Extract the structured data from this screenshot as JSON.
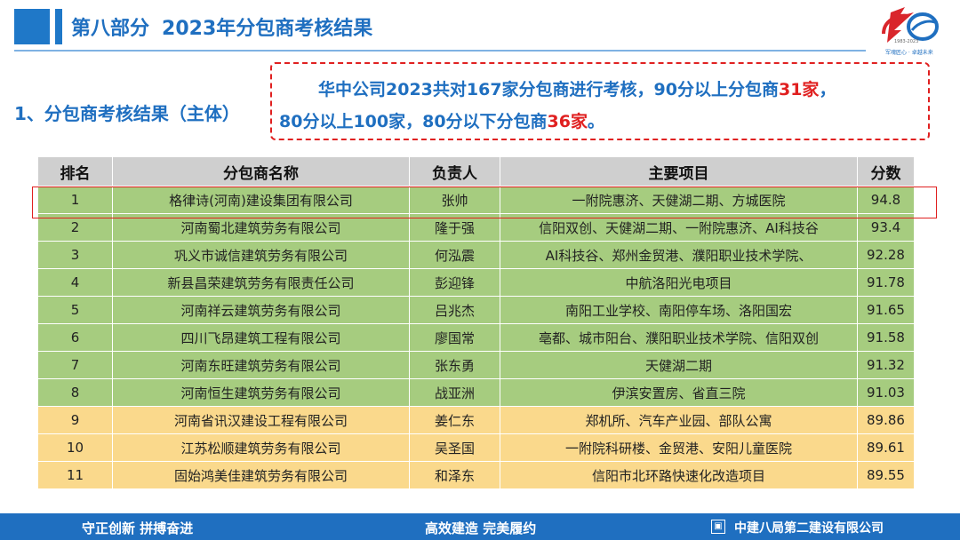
{
  "header": {
    "section": "第八部分",
    "title": "2023年分包商考核结果",
    "logo_years": "1983-2023",
    "logo_slogan": "军魂匠心 · 卓越未来"
  },
  "subtitle": "1、分包商考核结果（主体）",
  "summary": {
    "line1_before": "华中公司2023共对167家分包商进行考核，90分以上分包商",
    "line1_num": "31家",
    "line1_after": "，",
    "line2_before": "80分以上100家，80分以下分包商",
    "line2_num": "36家",
    "line2_after": "。"
  },
  "table": {
    "headers": [
      "排名",
      "分包商名称",
      "负责人",
      "主要项目",
      "分数"
    ],
    "rows": [
      [
        "1",
        "格律诗(河南)建设集团有限公司",
        "张帅",
        "一附院惠济、天健湖二期、方城医院",
        "94.8"
      ],
      [
        "2",
        "河南蜀北建筑劳务有限公司",
        "隆于强",
        "信阳双创、天健湖二期、一附院惠济、AI科技谷",
        "93.4"
      ],
      [
        "3",
        "巩义市诚信建筑劳务有限公司",
        "何泓震",
        "AI科技谷、郑州金贸港、濮阳职业技术学院、",
        "92.28"
      ],
      [
        "4",
        "新县昌荣建筑劳务有限责任公司",
        "彭迎锋",
        "中航洛阳光电项目",
        "91.78"
      ],
      [
        "5",
        "河南祥云建筑劳务有限公司",
        "吕兆杰",
        "南阳工业学校、南阳停车场、洛阳国宏",
        "91.65"
      ],
      [
        "6",
        "四川飞昂建筑工程有限公司",
        "廖国常",
        "亳都、城市阳台、濮阳职业技术学院、信阳双创",
        "91.58"
      ],
      [
        "7",
        "河南东旺建筑劳务有限公司",
        "张东勇",
        "天健湖二期",
        "91.32"
      ],
      [
        "8",
        "河南恒生建筑劳务有限公司",
        "战亚洲",
        "伊滨安置房、省直三院",
        "91.03"
      ],
      [
        "9",
        "河南省讯汉建设工程有限公司",
        "姜仁东",
        "郑机所、汽车产业园、部队公寓",
        "89.86"
      ],
      [
        "10",
        "江苏松顺建筑劳务有限公司",
        "吴圣国",
        "一附院科研楼、金贸港、安阳儿童医院",
        "89.61"
      ],
      [
        "11",
        "固始鸿美佳建筑劳务有限公司",
        "和泽东",
        "信阳市北环路快速化改造项目",
        "89.55"
      ]
    ]
  },
  "footer": {
    "left": "守正创新  拼搏奋进",
    "center": "高效建造  完美履约",
    "right": "中建八局第二建设有限公司"
  },
  "colors": {
    "accent": "#1f6fc0",
    "highlight": "#e02020",
    "row_green": "#a6cc7f",
    "row_amber": "#fad98c"
  }
}
